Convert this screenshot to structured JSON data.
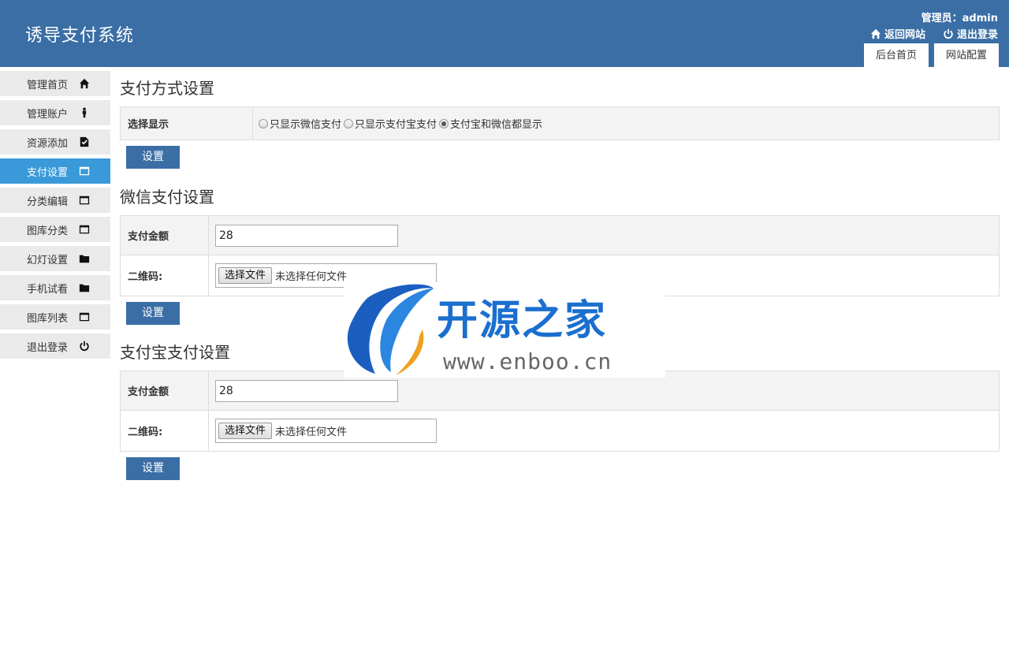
{
  "header": {
    "brand": "诱导支付系统",
    "admin_label": "管理员：admin",
    "links": [
      {
        "label": "返回网站",
        "icon": "home-icon"
      },
      {
        "label": "退出登录",
        "icon": "power-icon"
      }
    ],
    "tabs": [
      "后台首页",
      "网站配置"
    ]
  },
  "sidebar": {
    "items": [
      {
        "label": "管理首页",
        "icon": "home-icon"
      },
      {
        "label": "管理账户",
        "icon": "user-icon"
      },
      {
        "label": "资源添加",
        "icon": "document-icon"
      },
      {
        "label": "支付设置",
        "icon": "window-icon",
        "active": true
      },
      {
        "label": "分类编辑",
        "icon": "window-icon"
      },
      {
        "label": "图库分类",
        "icon": "window-icon"
      },
      {
        "label": "幻灯设置",
        "icon": "folder-icon"
      },
      {
        "label": "手机试看",
        "icon": "folder-icon"
      },
      {
        "label": "图库列表",
        "icon": "window-icon"
      },
      {
        "label": "退出登录",
        "icon": "power-icon"
      }
    ]
  },
  "payment_method": {
    "title": "支付方式设置",
    "label": "选择显示",
    "options": [
      "只显示微信支付",
      "只显示支付宝支付",
      "支付宝和微信都显示"
    ],
    "selected_index": 2,
    "button": "设置"
  },
  "wechat": {
    "title": "微信支付设置",
    "amount_label": "支付金额",
    "amount_value": "28",
    "qrcode_label": "二维码:",
    "file_button": "选择文件",
    "file_status": "未选择任何文件",
    "button": "设置"
  },
  "alipay": {
    "title": "支付宝支付设置",
    "amount_label": "支付金额",
    "amount_value": "28",
    "qrcode_label": "二维码:",
    "file_button": "选择文件",
    "file_status": "未选择任何文件",
    "button": "设置"
  },
  "watermark": {
    "text": "开源之家",
    "url": "www.enboo.cn"
  }
}
